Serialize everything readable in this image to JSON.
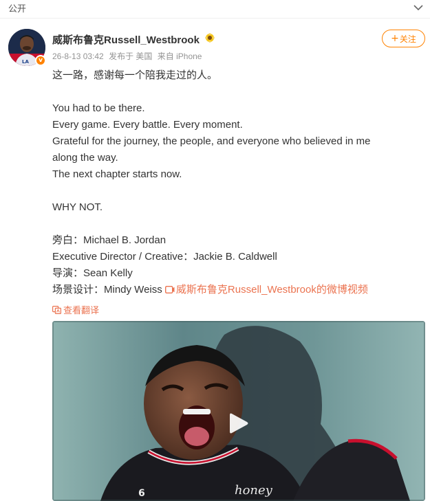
{
  "topbar": {
    "privacy_label": "公开",
    "chevron_icon": "chevron-down-icon"
  },
  "post": {
    "author": "威斯布鲁克Russell_Westbrook",
    "verified_icon": "sunflower-badge-icon",
    "timestamp": "26-8-13 03:42",
    "location": "发布于 美国",
    "source": "来自 iPhone",
    "follow_label": "关注",
    "follow_plus": "+",
    "lines": [
      "这一路，感谢每一个陪我走过的人。",
      "",
      "You had to be there.",
      "Every game. Every battle. Every moment.",
      "Grateful for the journey, the people, and everyone who believed in me",
      "along the way.",
      "The next chapter starts now.",
      "",
      "WHY NOT.",
      "",
      "旁白：Michael B. Jordan",
      "Executive Director / Creative：Jackie B. Caldwell",
      "导演：Sean Kelly"
    ],
    "last_line_prefix": "场景设计：Mindy Weiss ",
    "video_link_label": "威斯布鲁克Russell_Westbrook的微博视频",
    "translate_label": "查看翻译"
  },
  "video": {
    "jersey_text": "honey",
    "jersey_number": "6",
    "play_icon": "play-icon"
  },
  "colors": {
    "accent": "#ff8200",
    "link": "#eb7350",
    "meta_text": "#939393"
  }
}
